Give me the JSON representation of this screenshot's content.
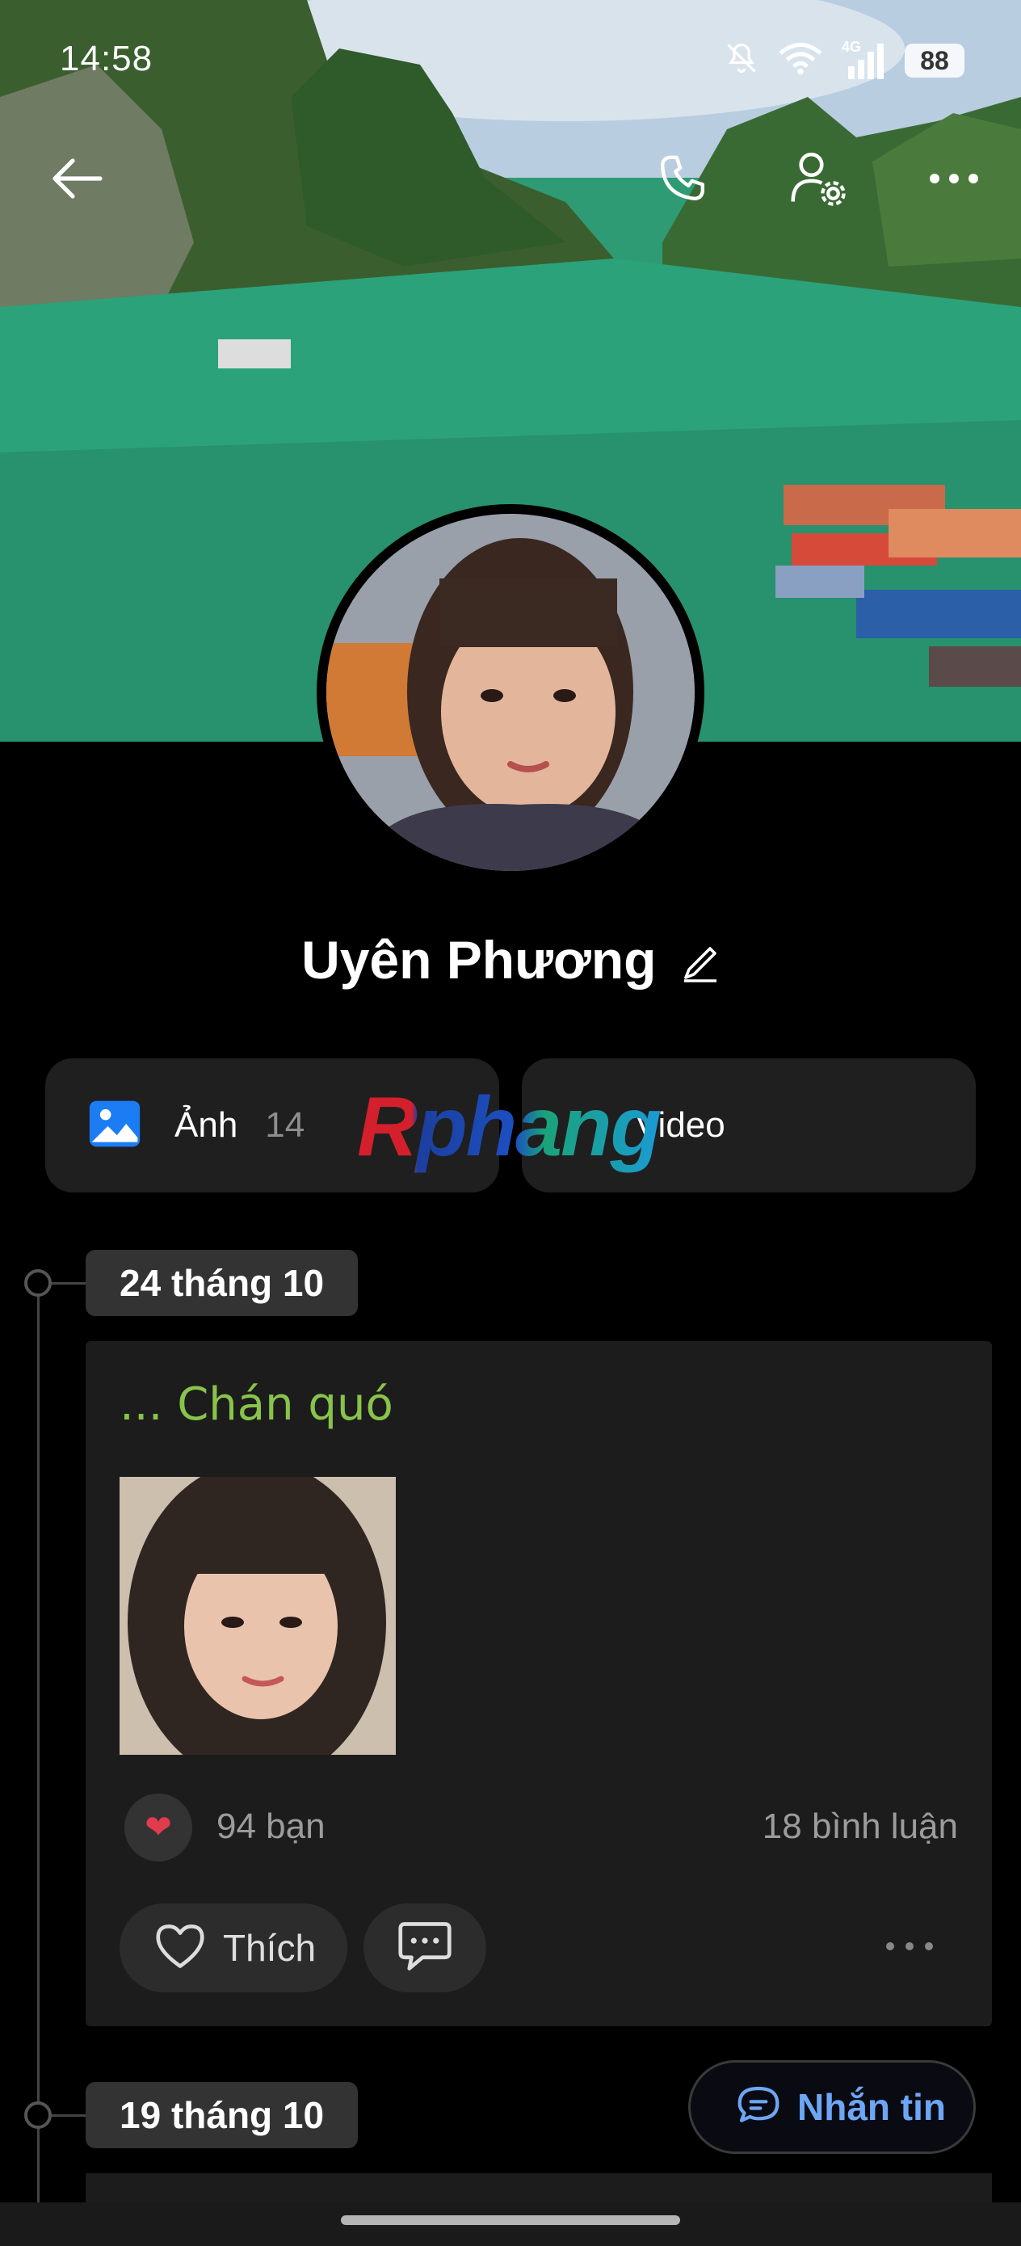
{
  "status_bar": {
    "time": "14:58",
    "network": "4G",
    "battery": "88"
  },
  "profile": {
    "name": "Uyên Phương"
  },
  "media": {
    "photos_label": "Ảnh",
    "photos_count": "14",
    "videos_label": "Video"
  },
  "watermark": "Rphang",
  "timeline": [
    {
      "date": "24 tháng 10",
      "post": {
        "text": "... Chán quó",
        "reaction_icon": "heart",
        "reaction_count": "94 bạn",
        "comment_count": "18 bình luận",
        "like_label": "Thích"
      }
    },
    {
      "date": "19 tháng 10"
    }
  ],
  "message_button": {
    "label": "Nhắn tin"
  },
  "colors": {
    "accent": "#6da6f5",
    "post_text": "#88c34a",
    "heart": "#e23b4e",
    "photo_icon": "#1c7cf4"
  }
}
